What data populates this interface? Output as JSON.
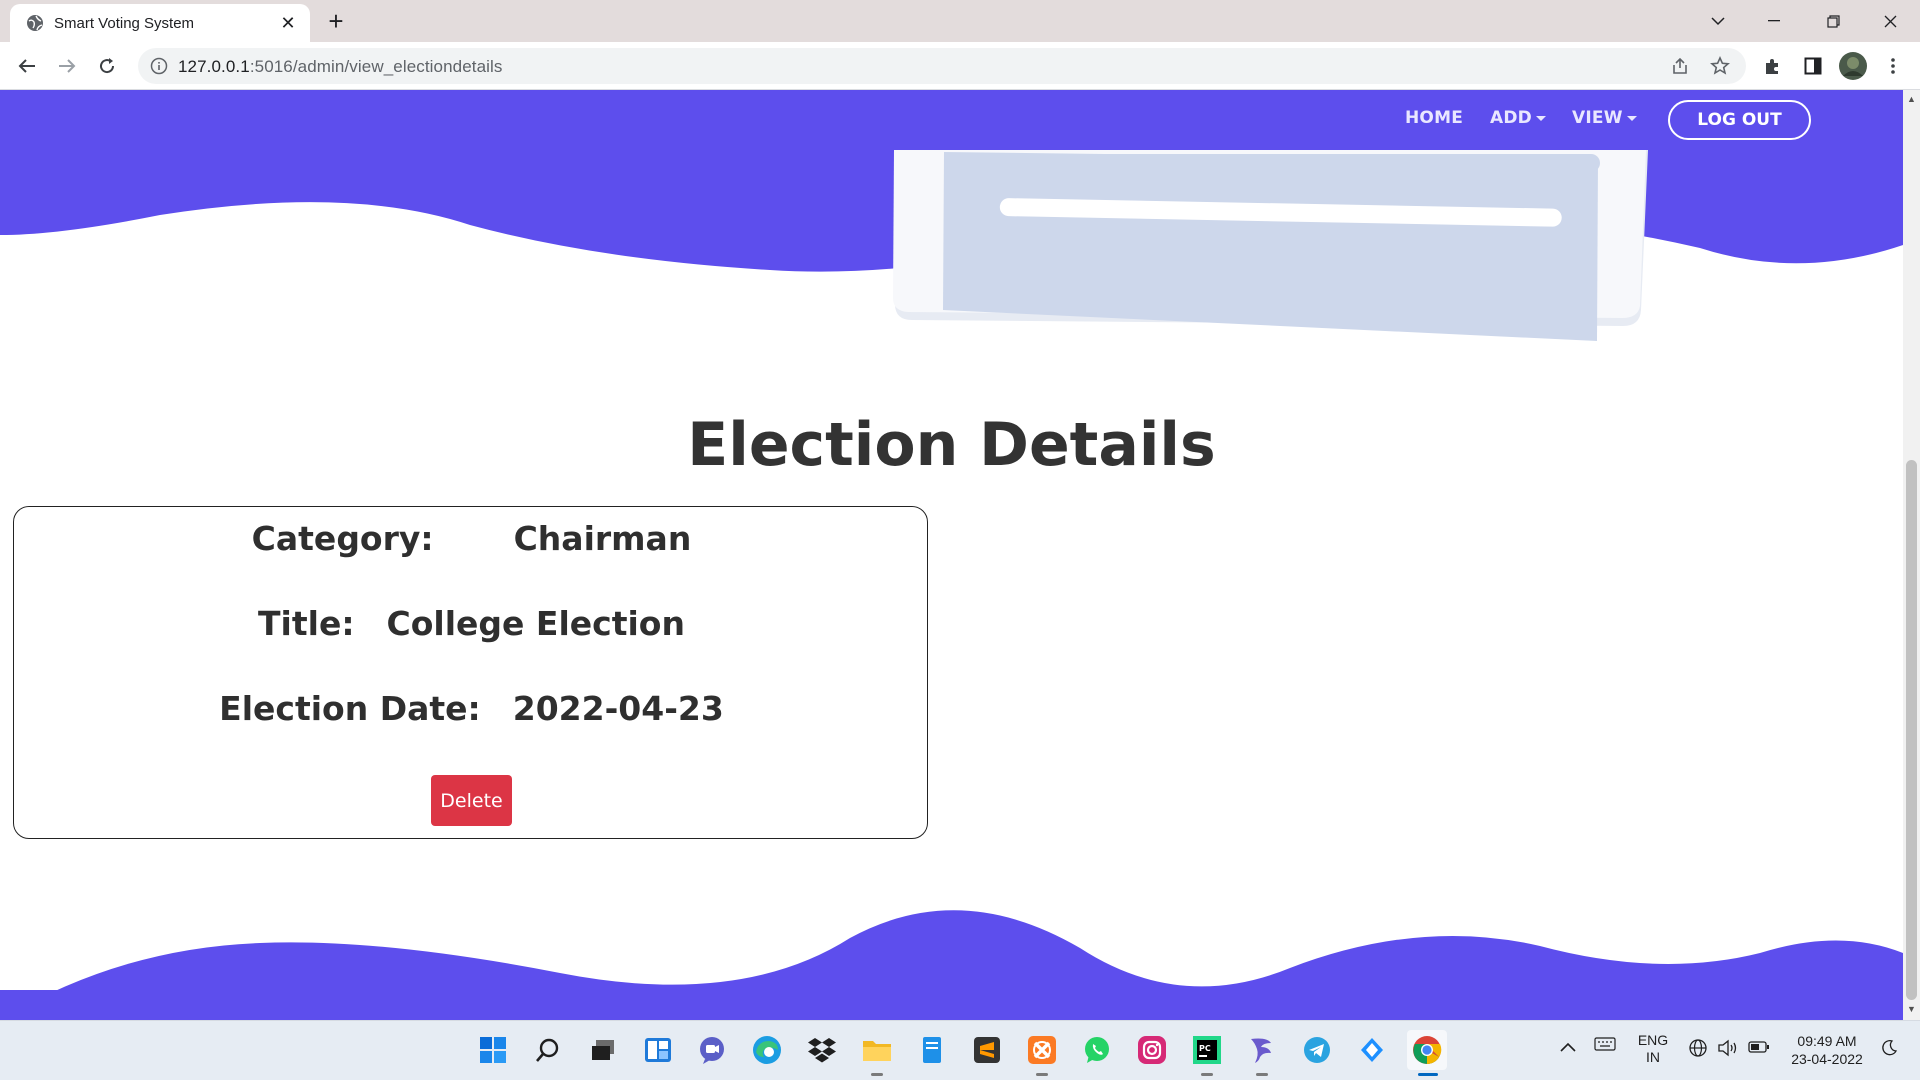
{
  "browser": {
    "tab_title": "Smart Voting System",
    "url_host": "127.0.0.1",
    "url_path": ":5016/admin/view_electiondetails"
  },
  "nav": {
    "home": "HOME",
    "add": "ADD",
    "view": "VIEW",
    "logout": "LOG OUT"
  },
  "page": {
    "heading": "Election Details"
  },
  "election": {
    "category_label": "Category:",
    "category_value": "Chairman",
    "title_label": "Title:",
    "title_value": "College Election",
    "date_label": "Election Date:",
    "date_value": "2022-04-23",
    "delete_label": "Delete"
  },
  "taskbar": {
    "lang_top": "ENG",
    "lang_bottom": "IN",
    "time": "09:49 AM",
    "date": "23-04-2022"
  },
  "colors": {
    "brand": "#5d4eed",
    "delete": "#dc3545",
    "text": "#333333"
  }
}
